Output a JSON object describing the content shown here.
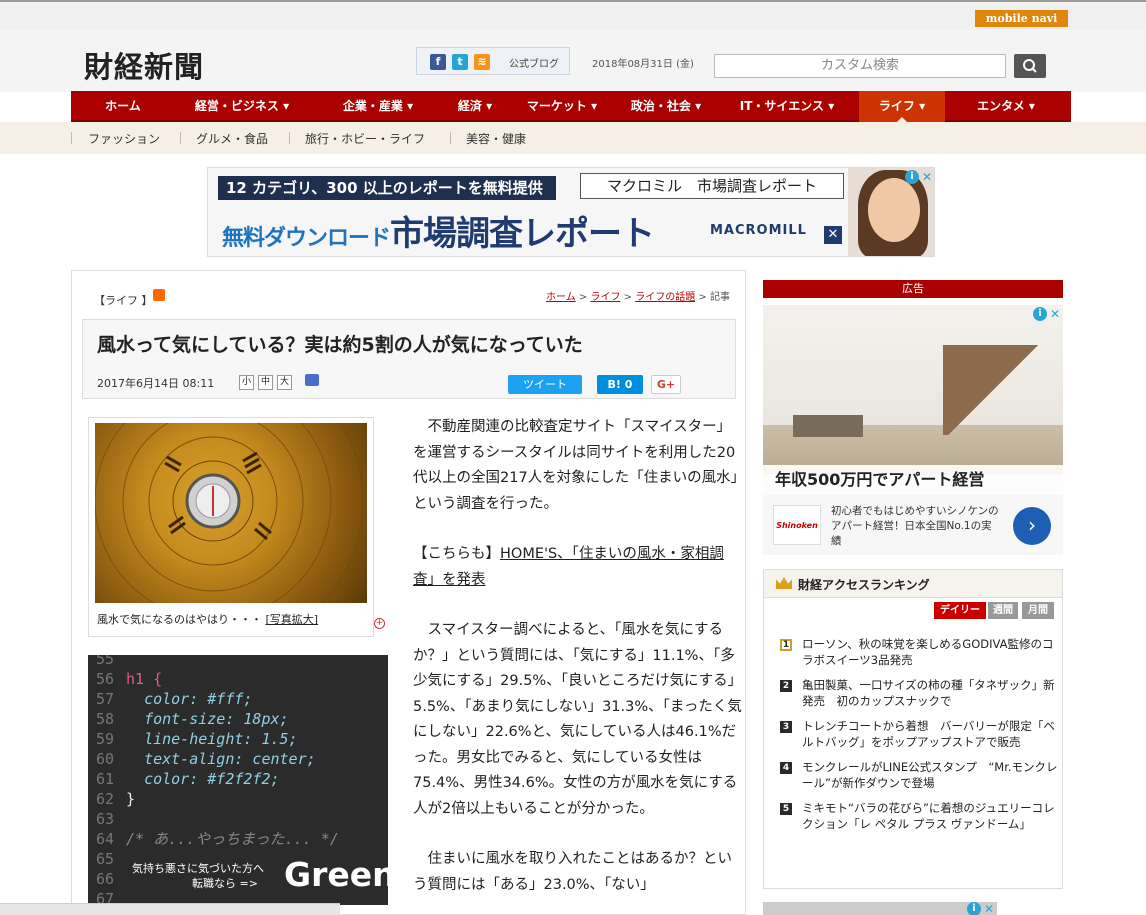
{
  "brand": {
    "mobile": "mobile navi",
    "logo": "財経新聞",
    "blog_link": "公式ブログ",
    "date": "2018年08月31日 (金)",
    "search_placeholder": "カスタム検索"
  },
  "nav": {
    "items": [
      "ホーム",
      "経営・ビジネス ▾",
      "企業・産業 ▾",
      "経済 ▾",
      "マーケット ▾",
      "政治・社会 ▾",
      "IT・サイエンス ▾",
      "ライフ ▾",
      "エンタメ ▾"
    ],
    "active": "ライフ ▾"
  },
  "subnav": {
    "items": [
      "ファッション",
      "グルメ・食品",
      "旅行・ホビー・ライフ",
      "美容・健康"
    ]
  },
  "banner": {
    "top_text": "12 カテゴリ、300 以上のレポートを無料提供",
    "brand_text": "マクロミル　市場調査レポート",
    "main_sub": "無料ダウンロード",
    "main_text": "市場調査レポート",
    "logo_text": "MACROMILL"
  },
  "article": {
    "category": "【ライフ 】",
    "breadcrumb": {
      "home": "ホーム",
      "life": "ライフ",
      "topic": "ライフの話題",
      "current": "記事"
    },
    "title": "風水って気にしている？実は約5割の人が気になっていた",
    "date": "2017年6月14日 08:11",
    "font_sizes": [
      "小",
      "中",
      "大"
    ],
    "share": {
      "tweet": "ツイート",
      "hatena": "B! 0",
      "gplus": "G+"
    },
    "photo_caption": "風水で気になるのはやはり・・・",
    "photo_zoom": "[写真拡大]",
    "para1": "不動産関連の比較査定サイト「スマイスター」を運営するシースタイルは同サイトを利用した20代以上の全国217人を対象にした「住まいの風水」という調査を行った。",
    "related_prefix": "【こちらも】",
    "related_link": "HOME'S、「住まいの風水・家相調査」を発表",
    "para2": "スマイスター調べによると、「風水を気にするか？」という質問には、「気にする」11.1%、「多少気にする」29.5%、「良いところだけ気にする」5.5%、「あまり気にしない」31.3%、「まったく気にしない」22.6%と、気にしている人は46.1%だった。男女比でみると、気にしている女性は75.4%、男性34.6%。女性の方が風水を気にする人が2倍以上もいることが分かった。",
    "para3": "住まいに風水を取り入れたことはあるか？という質問には「ある」23.0%、「ない」"
  },
  "code_ad": {
    "lines": [
      {
        "n": "55",
        "t": ""
      },
      {
        "n": "56",
        "t": "h1 {"
      },
      {
        "n": "57",
        "t": "color: #fff;"
      },
      {
        "n": "58",
        "t": "font-size: 18px;"
      },
      {
        "n": "59",
        "t": "line-height: 1.5;"
      },
      {
        "n": "60",
        "t": "text-align: center;"
      },
      {
        "n": "61",
        "t": "color: #f2f2f2;"
      },
      {
        "n": "62",
        "t": "}"
      },
      {
        "n": "63",
        "t": ""
      },
      {
        "n": "64",
        "t": "/* あ...やっちまった... */"
      },
      {
        "n": "65",
        "t": ""
      },
      {
        "n": "66",
        "t": ""
      },
      {
        "n": "67",
        "t": ""
      }
    ],
    "msg1": "気持ち悪さに気づいた方へ",
    "msg2": "転職なら =>",
    "brand": "Green"
  },
  "sidebar": {
    "ad_label": "広告",
    "ad_headline": "年収500万円でアパート経営",
    "ad_desc": "初心者でもはじめやすいシノケンのアパート経営！日本全国No.1の実績",
    "ad_logo": "Shinoken",
    "ranking_title": "財経アクセスランキング",
    "tabs": [
      "デイリー",
      "週間",
      "月間"
    ],
    "items": [
      {
        "rank": "1",
        "text": "ローソン、秋の味覚を楽しめるGODIVA監修のコラボスイーツ3品発売"
      },
      {
        "rank": "2",
        "text": "亀田製菓、一口サイズの柿の種「タネザック」新発売　初のカップスナックで"
      },
      {
        "rank": "3",
        "text": "トレンチコートから着想　バーバリーが限定「ベルトバッグ」をポップアップストアで販売"
      },
      {
        "rank": "4",
        "text": "モンクレールがLINE公式スタンプ　“Mr.モンクレール”が新作ダウンで登場"
      },
      {
        "rank": "5",
        "text": "ミキモト“バラの花びら”に着想のジュエリーコレクション「レ ペタル プラス ヴァンドーム」"
      }
    ]
  },
  "colors": {
    "nav_red": "#aa0000",
    "nav_active": "#cc3300",
    "twitter": "#1da1f2",
    "hatena": "#008fde"
  }
}
